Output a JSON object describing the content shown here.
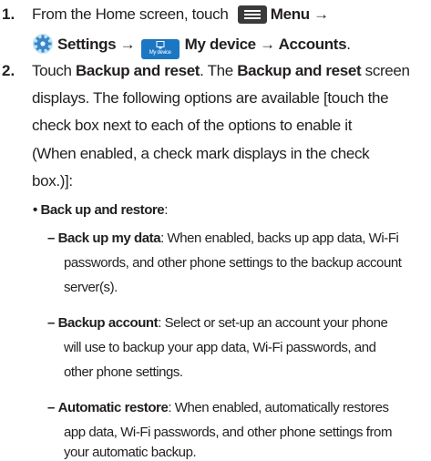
{
  "steps": [
    {
      "number": "1.",
      "line1": {
        "prefix": "From the Home screen, touch ",
        "menu_icon": "menu-icon",
        "menu_label": "Menu",
        "arrow": " →"
      },
      "line2": {
        "gear_icon": "gear-icon",
        "settings_label": "Settings",
        "arrow1": " → ",
        "device_icon_caption": "My device",
        "device_label": "My device",
        "arrow2": " → ",
        "accounts_label": "Accounts",
        "end": "."
      }
    },
    {
      "number": "2.",
      "lines": {
        "l1a": "Touch ",
        "l1b": "Backup and reset",
        "l1c": ". The ",
        "l1d": "Backup and reset",
        "l1e": " screen",
        "l2": "displays. The following options are available [touch the",
        "l3": "check box next to each of the options to enable it",
        "l4": "(When enabled, a check mark displays in the check",
        "l5": "box.)]:"
      }
    }
  ],
  "bullet": {
    "marker": "•",
    "label": "Back up and restore",
    "colon": ":"
  },
  "options": [
    {
      "dash": "–",
      "title": "Back up my data",
      "lines": [
        ": When enabled, backs up app data, Wi-Fi",
        "passwords, and other phone settings to the backup account",
        "server(s)."
      ]
    },
    {
      "dash": "–",
      "title": "Backup account",
      "lines": [
        ": Select or set-up an account your phone",
        "will use to backup your app data, Wi-Fi passwords, and",
        "other phone settings."
      ]
    },
    {
      "dash": "–",
      "title": "Automatic restore",
      "lines": [
        ": When enabled, automatically restores",
        "app data, Wi-Fi passwords, and other phone settings from",
        "your automatic backup."
      ]
    }
  ]
}
